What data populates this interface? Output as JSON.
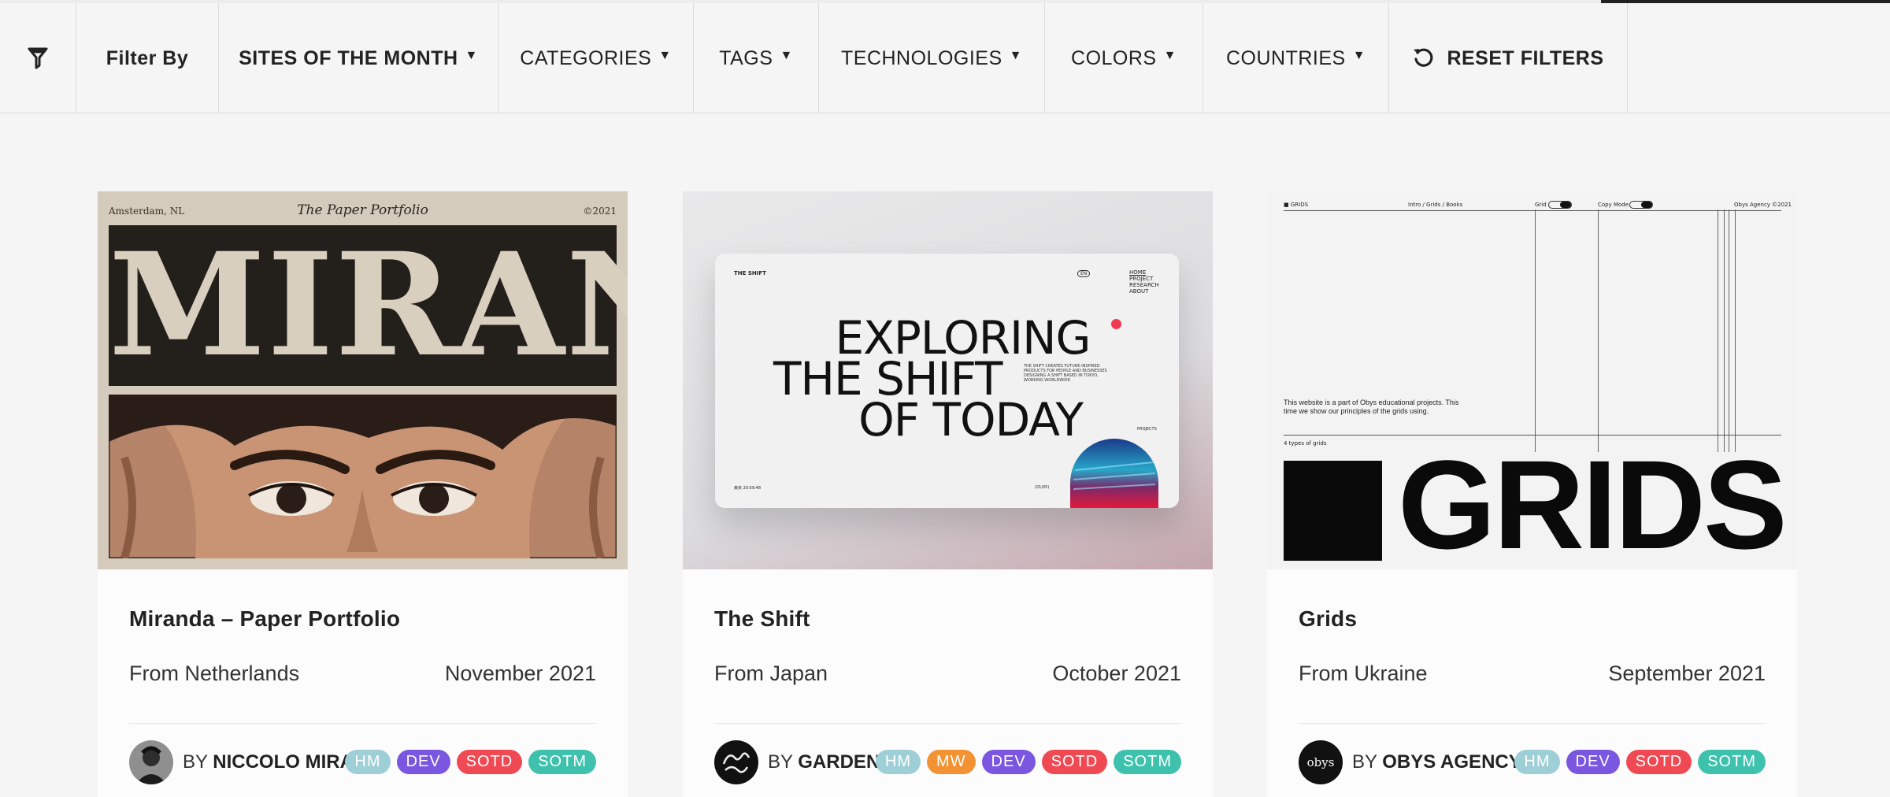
{
  "filter_bar": {
    "filter_by_label": "Filter By",
    "items": [
      {
        "label": "SITES OF THE MONTH"
      },
      {
        "label": "CATEGORIES"
      },
      {
        "label": "TAGS"
      },
      {
        "label": "TECHNOLOGIES"
      },
      {
        "label": "COLORS"
      },
      {
        "label": "COUNTRIES"
      }
    ],
    "reset_label": "RESET FILTERS",
    "icons": {
      "filter": "funnel-icon",
      "reset": "reset-icon",
      "caret": "caret-down-icon"
    }
  },
  "cards": [
    {
      "title": "Miranda – Paper Portfolio",
      "from": "From Netherlands",
      "date": "November 2021",
      "by": "BY",
      "author": "NICCOLO MIRA...",
      "badges": [
        "HM",
        "DEV",
        "SOTD",
        "SOTM"
      ],
      "thumb": {
        "left": "Amsterdam, NL",
        "center": "The Paper Portfolio",
        "right": "©2021",
        "headline": "MIRANDA"
      }
    },
    {
      "title": "The Shift",
      "from": "From Japan",
      "date": "October 2021",
      "by": "BY",
      "author": "GARDEN E...",
      "badges": [
        "HM",
        "MW",
        "DEV",
        "SOTD",
        "SOTM"
      ],
      "thumb": {
        "brand": "THE SHIFT",
        "lang": "EN",
        "nav": [
          "HOME",
          "PROJECT",
          "RESEARCH",
          "ABOUT"
        ],
        "line1": "EXPLORING",
        "line2": "THE SHIFT",
        "line3": "OF TODAY",
        "blurb": "THE SHIFT CREATES FUTURE-INSPIRED PRODUCTS FOR PEOPLE AND BUSINESSES DESIGNING A SHIFT BASED IN TOKYO, WORKING WORLDWIDE.",
        "projects": "PROJECTS",
        "time": "東京 20:59:48",
        "count": "(01/05)"
      }
    },
    {
      "title": "Grids",
      "from": "From Ukraine",
      "date": "September 2021",
      "by": "BY",
      "author": "OBYS AGENCY",
      "badges": [
        "HM",
        "DEV",
        "SOTD",
        "SOTM"
      ],
      "thumb": {
        "brand": "■ GRIDS",
        "nav": "Intro / Grids / Books",
        "grid": "Grid",
        "copy_mode": "Copy Mode",
        "agency": "Obys Agency ©2021",
        "para": "This website is a part of Obys educational projects. This time we show our principles of the grids using.",
        "types": "4 types of grids",
        "headline": "GRIDS",
        "logo": "obys"
      }
    }
  ],
  "badge_colors": {
    "HM": "#9fcfd6",
    "MW": "#f29232",
    "DEV": "#7b56e0",
    "SOTD": "#ef4a54",
    "SOTM": "#3fc2ad"
  }
}
